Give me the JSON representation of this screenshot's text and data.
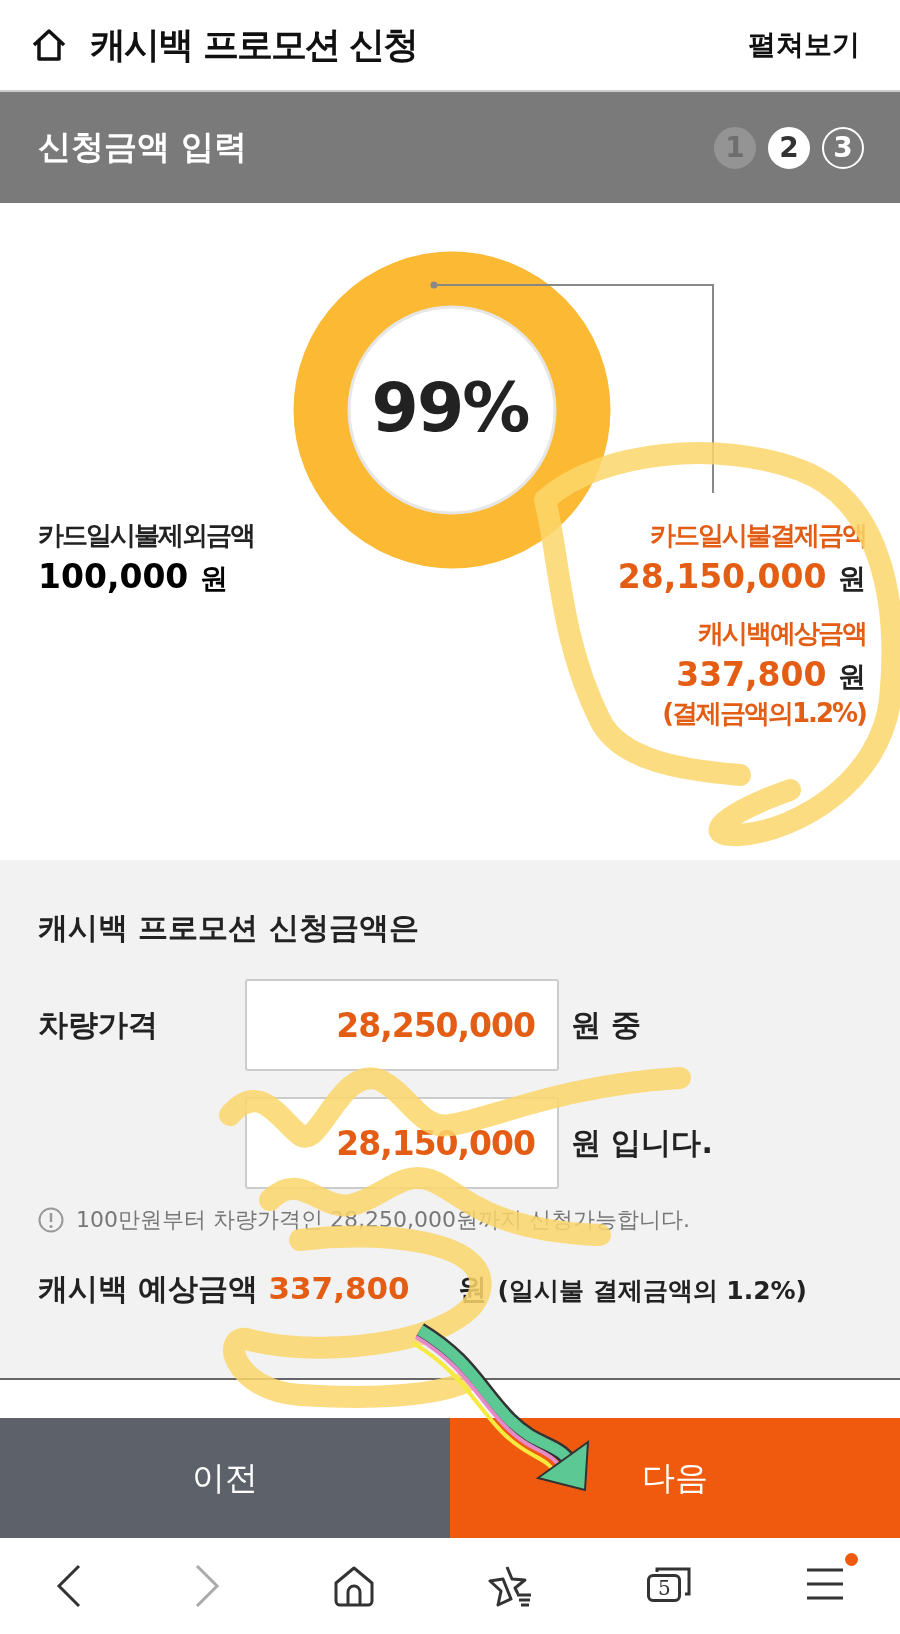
{
  "header": {
    "title": "캐시백 프로모션 신청",
    "action": "펼쳐보기"
  },
  "section": {
    "title": "신청금액 입력",
    "steps": [
      {
        "label": "1",
        "selected": false,
        "completed": true
      },
      {
        "label": "2",
        "selected": true,
        "completed": false
      },
      {
        "label": "3",
        "selected": false,
        "completed": false
      }
    ]
  },
  "summary": {
    "donut": {
      "label": "99%"
    },
    "left": {
      "label": "카드일시불제외금액",
      "amount": "100,000",
      "unit": "원"
    },
    "right": [
      {
        "label": "카드일시불결제금액",
        "amount": "28,150,000",
        "unit": "원"
      },
      {
        "label": "캐시백예상금액",
        "amount": "337,800",
        "unit": "원",
        "note": "(결제금액의1.2%)"
      }
    ]
  },
  "form": {
    "title": "캐시백 프로모션 신청금액은",
    "rows": [
      {
        "label": "차량가격",
        "value": "28,250,000",
        "suffix": "원 중"
      },
      {
        "value": "28,150,000",
        "suffix": "원 입니다."
      }
    ],
    "notice": "100만원부터 차량가격인 28,250,000원까지 신청가능합니다.",
    "cashback": {
      "label": "캐시백 예상금액",
      "value": "337,800",
      "suffix": "원",
      "note": "(일시불 결제금액의 1.2%)"
    }
  },
  "buttons": [
    {
      "label": "이전",
      "kind": "prev"
    },
    {
      "label": "다음",
      "kind": "next"
    }
  ],
  "browser_bar": {
    "tab_count": "5",
    "forward_disabled": true,
    "menu_badge": true
  }
}
